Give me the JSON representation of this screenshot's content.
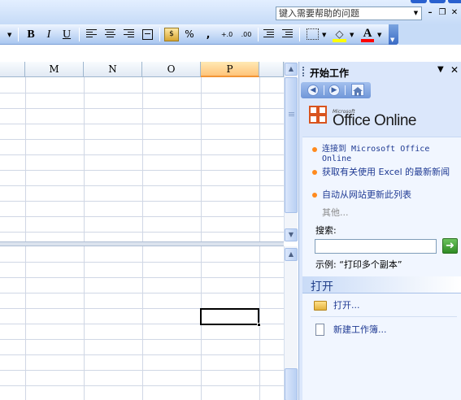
{
  "window": {
    "help_search_placeholder": "键入需要帮助的问题"
  },
  "toolbar": {
    "bold": "B",
    "italic": "I",
    "underline": "U",
    "percent": "%",
    "comma": ",",
    "inc_decimal": "+.0",
    "dec_decimal": ".00",
    "font_color_letter": "A"
  },
  "grid": {
    "columns": [
      "M",
      "N",
      "O",
      "P"
    ],
    "selected_column": "P"
  },
  "task_pane": {
    "title": "开始工作",
    "logo_brand_small": "Microsoft",
    "logo_text": "Office Online",
    "links": [
      "连接到 Microsoft Office Online",
      "获取有关使用 Excel 的最新新闻",
      "自动从网站更新此列表"
    ],
    "more": "其他...",
    "search_label": "搜索:",
    "search_value": "",
    "example_text": "示例:   “打印多个副本”",
    "open_section_title": "打开",
    "open_items": [
      "打开...",
      "新建工作簿..."
    ]
  },
  "colors": {
    "accent": "#2a61cf",
    "pane_bg": "#dbe7fb",
    "selected_header": "#ffc47a",
    "bullet": "#ff8a1e"
  },
  "icons": [
    "gear-icon",
    "close-icon",
    "chevron-down-icon",
    "home-icon",
    "back-icon",
    "forward-icon",
    "go-arrow-icon",
    "folder-icon",
    "document-icon"
  ]
}
